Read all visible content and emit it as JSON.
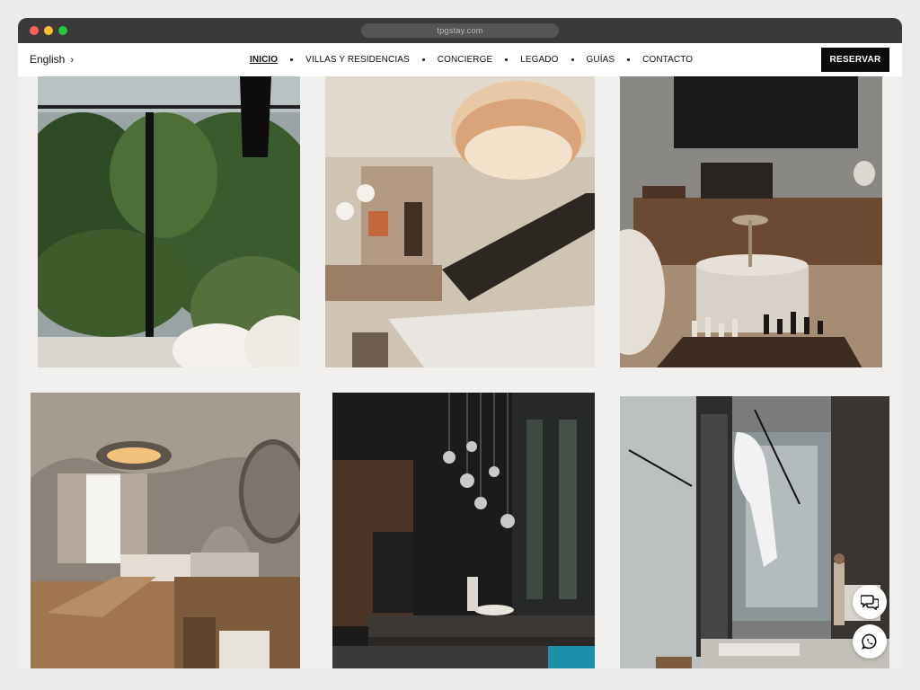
{
  "browser": {
    "url": "tpgstay.com"
  },
  "header": {
    "language": "English",
    "menu": [
      {
        "label": "INICIO",
        "active": true
      },
      {
        "label": "VILLAS Y RESIDENCIAS"
      },
      {
        "label": "CONCIERGE"
      },
      {
        "label": "LEGADO"
      },
      {
        "label": "GUÍAS"
      },
      {
        "label": "CONTACTO"
      }
    ],
    "cta": "RESERVAR"
  },
  "gallery": [
    {
      "subject": "jungle view through glass window"
    },
    {
      "subject": "shell chandelier and floating staircase"
    },
    {
      "subject": "living room with chess table"
    },
    {
      "subject": "bedroom with curved ceiling and stone tub"
    },
    {
      "subject": "dark kitchen with glass pendant lights"
    },
    {
      "subject": "double-height living room with sculpture"
    }
  ],
  "floating_buttons": {
    "chat": "chat-icon",
    "whatsapp": "whatsapp-icon"
  }
}
